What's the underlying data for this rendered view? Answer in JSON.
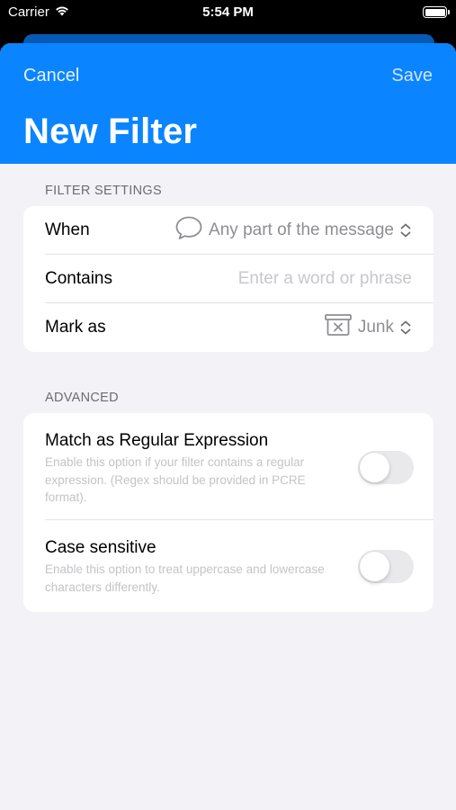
{
  "status_bar": {
    "carrier": "Carrier",
    "time": "5:54 PM"
  },
  "nav": {
    "cancel_label": "Cancel",
    "save_label": "Save",
    "title": "New Filter"
  },
  "filter_settings": {
    "header": "FILTER SETTINGS",
    "when": {
      "label": "When",
      "value": "Any part of the message",
      "icon": "speech-bubble-icon"
    },
    "contains": {
      "label": "Contains",
      "value": "",
      "placeholder": "Enter a word or phrase"
    },
    "mark_as": {
      "label": "Mark as",
      "value": "Junk",
      "icon": "junk-bin-icon"
    }
  },
  "advanced": {
    "header": "ADVANCED",
    "regex": {
      "title": "Match as Regular Expression",
      "description": "Enable this option if your filter contains a regular expression.  (Regex should be provided in PCRE format).",
      "enabled": false
    },
    "case_sensitive": {
      "title": "Case sensitive",
      "description": "Enable this option to treat uppercase and lowercase characters differently.",
      "enabled": false
    }
  },
  "colors": {
    "accent": "#0a84ff",
    "background": "#f2f2f7",
    "secondary_text": "#8e8e93"
  }
}
